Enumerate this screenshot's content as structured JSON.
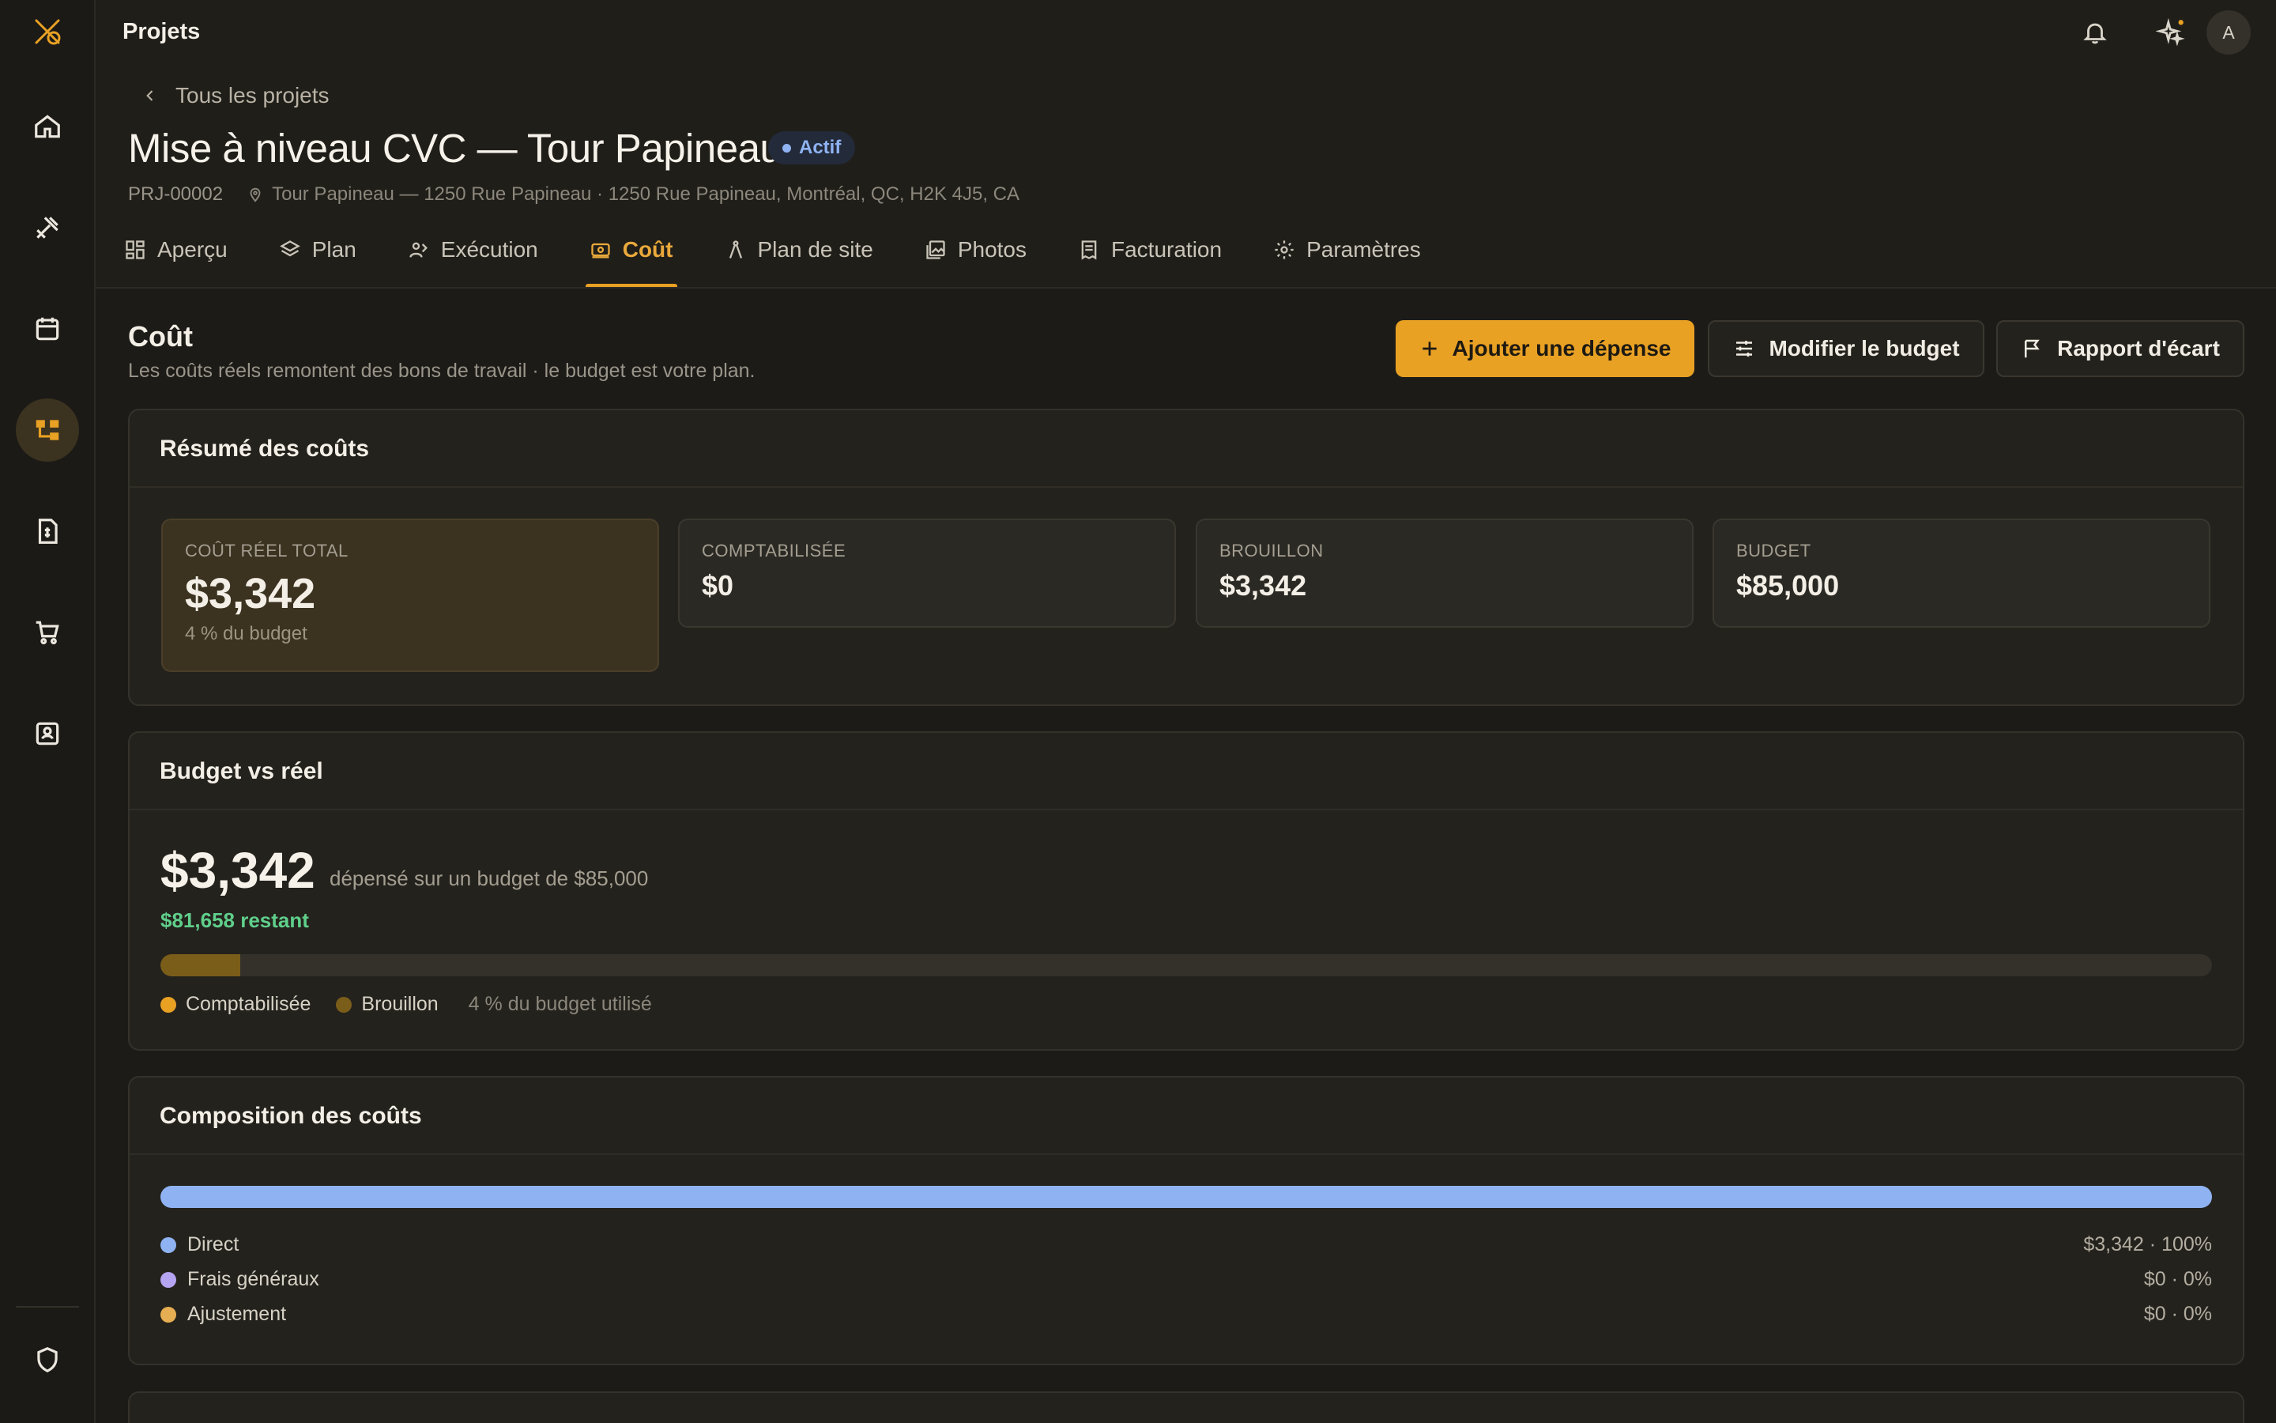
{
  "topbar": {
    "title": "Projets",
    "avatar_initial": "A"
  },
  "header": {
    "back_label": "Tous les projets",
    "title": "Mise à niveau CVC — Tour Papineau",
    "status": "Actif",
    "code": "PRJ-00002",
    "location": "Tour Papineau — 1250 Rue Papineau · 1250 Rue Papineau, Montréal, QC, H2K 4J5, CA"
  },
  "tabs": [
    {
      "label": "Aperçu",
      "icon": "grid-icon"
    },
    {
      "label": "Plan",
      "icon": "layers-icon"
    },
    {
      "label": "Exécution",
      "icon": "people-icon"
    },
    {
      "label": "Coût",
      "icon": "money-icon",
      "active": true
    },
    {
      "label": "Plan de site",
      "icon": "compass-icon"
    },
    {
      "label": "Photos",
      "icon": "image-icon"
    },
    {
      "label": "Facturation",
      "icon": "receipt-icon"
    },
    {
      "label": "Paramètres",
      "icon": "gear-icon"
    }
  ],
  "section": {
    "title": "Coût",
    "subtitle": "Les coûts réels remontent des bons de travail · le budget est votre plan.",
    "actions": {
      "add_expense": "Ajouter une dépense",
      "edit_budget": "Modifier le budget",
      "variance_report": "Rapport d'écart"
    }
  },
  "summary": {
    "title": "Résumé des coûts",
    "stats": [
      {
        "label": "COÛT RÉEL TOTAL",
        "value": "$3,342",
        "note": "4 % du budget"
      },
      {
        "label": "COMPTABILISÉE",
        "value": "$0"
      },
      {
        "label": "BROUILLON",
        "value": "$3,342"
      },
      {
        "label": "BUDGET",
        "value": "$85,000"
      }
    ]
  },
  "budget_vs_actual": {
    "title": "Budget vs réel",
    "spent": "$3,342",
    "description": "dépensé sur un budget de $85,000",
    "remaining": "$81,658 restant",
    "usage_fraction": 0.039,
    "legend": [
      {
        "label": "Comptabilisée",
        "color": "#e9a124"
      },
      {
        "label": "Brouillon",
        "color": "#7b5d1a"
      }
    ],
    "usage_text": "4 % du budget utilisé"
  },
  "composition": {
    "title": "Composition des coûts",
    "rows": [
      {
        "label": "Direct",
        "value": "$3,342 · 100%",
        "color": "#8fb3f2"
      },
      {
        "label": "Frais généraux",
        "value": "$0 · 0%",
        "color": "#b4a4f2"
      },
      {
        "label": "Ajustement",
        "value": "$0 · 0%",
        "color": "#e6ae52"
      }
    ]
  },
  "colors": {
    "accent": "#e9a124",
    "success": "#5fcf8b",
    "info": "#8fb3f2"
  }
}
